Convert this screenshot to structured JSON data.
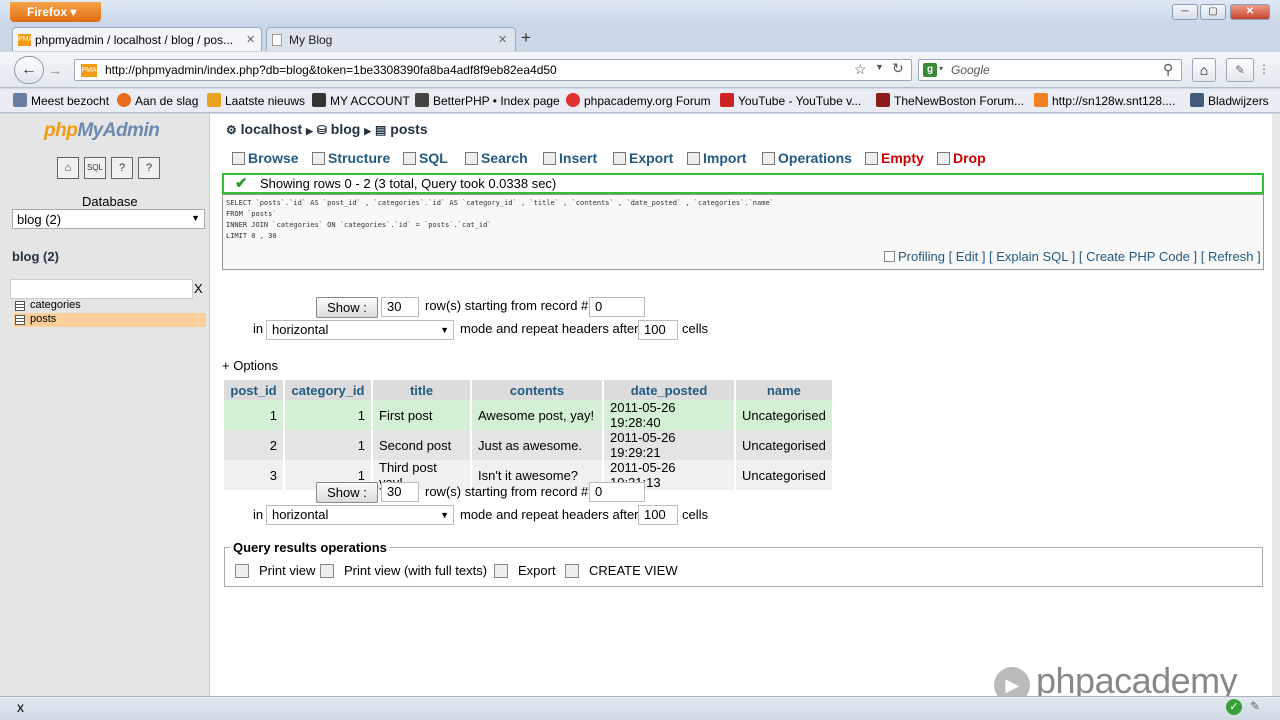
{
  "window": {
    "browser_button": "Firefox"
  },
  "tabs": [
    {
      "title": "phpmyadmin / localhost / blog / pos..."
    },
    {
      "title": "My Blog"
    }
  ],
  "nav": {
    "url": "http://phpmyadmin/index.php?db=blog&token=1be3308390fa8ba4adf8f9eb82ea4d50",
    "search_placeholder": "Google"
  },
  "bookmarks": [
    {
      "label": "Meest bezocht",
      "color": "#6a7f9f"
    },
    {
      "label": "Aan de slag",
      "color": "#e86b1f"
    },
    {
      "label": "Laatste nieuws",
      "color": "#e8a21f"
    },
    {
      "label": "MY ACCOUNT",
      "color": "#333333"
    },
    {
      "label": "BetterPHP • Index page",
      "color": "#444444"
    },
    {
      "label": "phpacademy.org Forum",
      "color": "#e03030"
    },
    {
      "label": "YouTube - YouTube v...",
      "color": "#cc2222"
    },
    {
      "label": "TheNewBoston Forum...",
      "color": "#8b1a1a"
    },
    {
      "label": "http://sn128w.snt128....",
      "color": "#f08020"
    },
    {
      "label": "Bladwijzers",
      "color": "#445a7a"
    }
  ],
  "sidebar": {
    "logo_php": "php",
    "logo_rest": "MyAdmin",
    "database_label": "Database",
    "database_value": "blog (2)",
    "db_title": "blog (2)",
    "filter_clear": "X",
    "tables": [
      "categories",
      "posts"
    ]
  },
  "breadcrumb": {
    "server": "localhost",
    "db": "blog",
    "table": "posts"
  },
  "tabs_row": [
    {
      "label": "Browse"
    },
    {
      "label": "Structure"
    },
    {
      "label": "SQL"
    },
    {
      "label": "Search"
    },
    {
      "label": "Insert"
    },
    {
      "label": "Export"
    },
    {
      "label": "Import"
    },
    {
      "label": "Operations"
    },
    {
      "label": "Empty"
    },
    {
      "label": "Drop"
    }
  ],
  "result": {
    "message": "Showing rows 0 - 2 (3 total, Query took 0.0338 sec)",
    "sql": [
      "SELECT `posts`.`id` AS `post_id` , `categories`.`id` AS `category_id` , `title` , `contents` , `date_posted` , `categories`.`name`",
      "FROM `posts`",
      "INNER JOIN `categories` ON `categories`.`id` = `posts`.`cat_id`",
      "LIMIT 0 , 30"
    ],
    "links": "Profiling [ Edit ] [ Explain SQL ] [ Create PHP Code ] [ Refresh ]"
  },
  "navform": {
    "show_label": "Show :",
    "rows_value": "30",
    "rows_text": "row(s) starting from record #",
    "start_value": "0",
    "in_text": "in",
    "mode_value": "horizontal",
    "mode_text": "mode and repeat headers after",
    "repeat_value": "100",
    "cells_text": "cells"
  },
  "options_label": "+ Options",
  "table": {
    "columns": [
      "post_id",
      "category_id",
      "title",
      "contents",
      "date_posted",
      "name"
    ],
    "rows": [
      [
        "1",
        "1",
        "First post",
        "Awesome post, yay!",
        "2011-05-26 19:28:40",
        "Uncategorised"
      ],
      [
        "2",
        "1",
        "Second post",
        "Just as awesome.",
        "2011-05-26 19:29:21",
        "Uncategorised"
      ],
      [
        "3",
        "1",
        "Third post yay!",
        "Isn't it awesome?",
        "2011-05-26 19:31:13",
        "Uncategorised"
      ]
    ]
  },
  "ops": {
    "legend": "Query results operations",
    "items": [
      "Print view",
      "Print view (with full texts)",
      "Export",
      "CREATE VIEW"
    ]
  },
  "watermark": "phpacademy",
  "status": {
    "close": "x"
  }
}
